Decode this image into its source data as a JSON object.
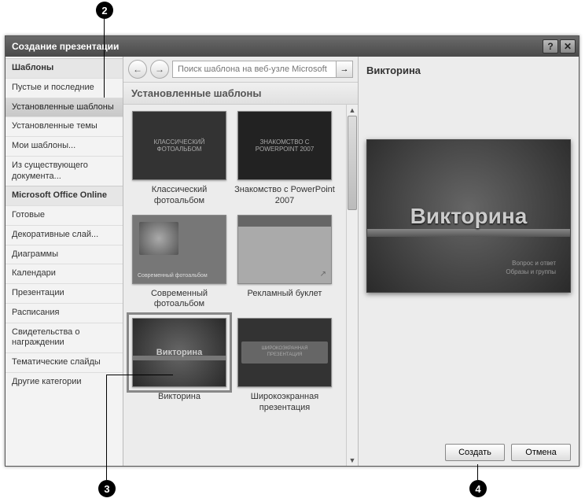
{
  "callouts": {
    "c2": "2",
    "c3": "3",
    "c4": "4"
  },
  "dialog": {
    "title": "Создание презентации",
    "help": "?",
    "close": "✕"
  },
  "sidebar": {
    "header1": "Шаблоны",
    "items1": [
      "Пустые и последние",
      "Установленные шаблоны",
      "Установленные темы",
      "Мои шаблоны...",
      "Из существующего документа..."
    ],
    "header2": "Microsoft Office Online",
    "items2": [
      "Готовые",
      "Декоративные слай...",
      "Диаграммы",
      "Календари",
      "Презентации",
      "Расписания",
      "Свидетельства о награждении",
      "Тематические слайды",
      "Другие категории"
    ]
  },
  "toolbar": {
    "back": "←",
    "fwd": "→",
    "placeholder": "Поиск шаблона на веб-узле Microsoft",
    "go": "→"
  },
  "section": {
    "title": "Установленные шаблоны"
  },
  "templates": [
    {
      "label": "Классический фотоальбом",
      "thumb_text": "КЛАССИЧЕСКИЙ ФОТОАЛЬБОМ"
    },
    {
      "label": "Знакомство с PowerPoint 2007",
      "thumb_text": "ЗНАКОМСТВО С POWERPOINT 2007"
    },
    {
      "label": "Современный фотоальбом",
      "thumb_text": "Современный фотоальбом"
    },
    {
      "label": "Рекламный буклет",
      "thumb_text": ""
    },
    {
      "label": "Викторина",
      "thumb_text": "Викторина",
      "selected": true
    },
    {
      "label": "Широкоэкранная презентация",
      "thumb_text": "ШИРОКОЭКРАННАЯ ПРЕЗЕНТАЦИЯ"
    }
  ],
  "preview": {
    "title": "Викторина",
    "big": "Викторина",
    "small1": "Вопрос и ответ",
    "small2": "Образы и группы"
  },
  "footer": {
    "create": "Создать",
    "cancel": "Отмена"
  }
}
